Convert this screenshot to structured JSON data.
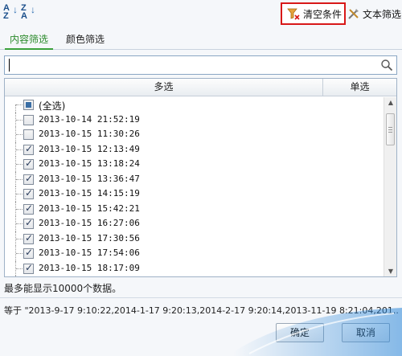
{
  "toolbar": {
    "sort_asc_label": "A",
    "sort_desc_label": "Z",
    "clear_label": "清空条件",
    "text_filter_label": "文本筛选"
  },
  "tabs": [
    {
      "label": "内容筛选",
      "active": true
    },
    {
      "label": "颜色筛选",
      "active": false
    }
  ],
  "search": {
    "value": "",
    "placeholder": ""
  },
  "list": {
    "header_multi": "多选",
    "header_single": "单选",
    "items": [
      {
        "label": "(全选)",
        "state": "partial"
      },
      {
        "label": "2013-10-14 21:52:19",
        "state": "unchecked"
      },
      {
        "label": "2013-10-15 11:30:26",
        "state": "unchecked"
      },
      {
        "label": "2013-10-15 12:13:49",
        "state": "checked"
      },
      {
        "label": "2013-10-15 13:18:24",
        "state": "checked"
      },
      {
        "label": "2013-10-15 13:36:47",
        "state": "checked"
      },
      {
        "label": "2013-10-15 14:15:19",
        "state": "checked"
      },
      {
        "label": "2013-10-15 15:42:21",
        "state": "checked"
      },
      {
        "label": "2013-10-15 16:27:06",
        "state": "checked"
      },
      {
        "label": "2013-10-15 17:30:56",
        "state": "checked"
      },
      {
        "label": "2013-10-15 17:54:06",
        "state": "checked"
      },
      {
        "label": "2013-10-15 18:17:09",
        "state": "checked"
      },
      {
        "label": "",
        "state": "checked"
      }
    ]
  },
  "footer": {
    "max_note": "最多能显示10000个数据。",
    "equals_text": "等于 \"2013-9-17 9:10:22,2014-1-17 9:20:13,2014-2-17 9:20:14,2013-11-19 8:21:04,201...",
    "ok_label": "确定",
    "cancel_label": "取消"
  },
  "colors": {
    "highlight_border": "#d81818",
    "active_tab": "#2a8a2a",
    "checkbox_partial": "#3a6ea5"
  }
}
